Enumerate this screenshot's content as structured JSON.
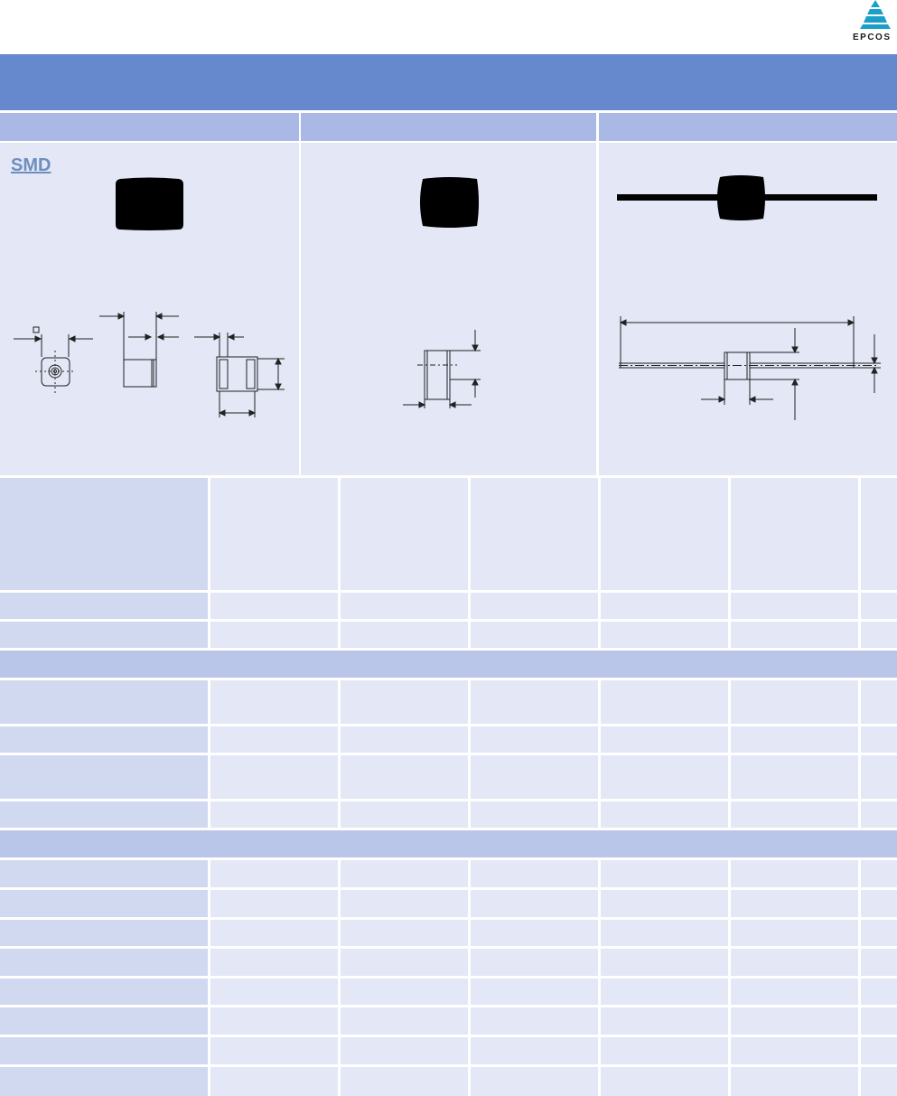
{
  "header": {
    "brand_logo": "EPCOS",
    "brand_color": "#6688cc"
  },
  "columns": {
    "smd_label": "SMD"
  },
  "colors": {
    "title_band": "#6688cc",
    "column_header": "#a9b8e4",
    "panel": "#e3e7f6",
    "label_cell": "#d1d9f1",
    "section_band": "#b9c6ea",
    "component_body": "#000000"
  },
  "icons": [
    "epcos-logo-icon",
    "smd-component-photo",
    "cylindrical-component-photo",
    "axial-component-photo",
    "smd-dimension-drawing",
    "cylindrical-dimension-drawing",
    "axial-dimension-drawing"
  ]
}
